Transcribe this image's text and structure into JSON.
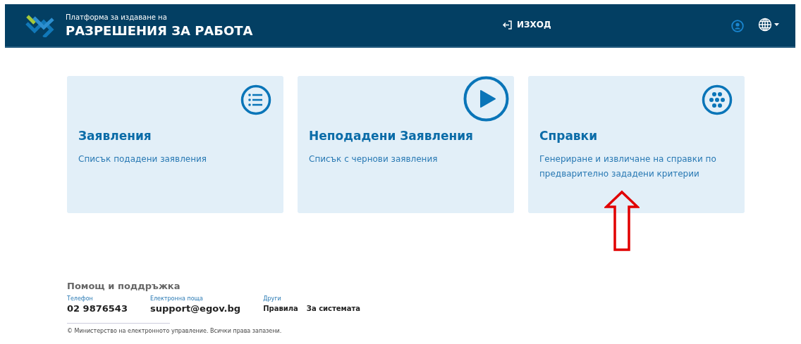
{
  "header": {
    "subtitle": "Платформа за издаване на",
    "title": "РАЗРЕШЕНИЯ ЗА РАБОТА",
    "logout": "ИЗХОД"
  },
  "cards": [
    {
      "kind": "list",
      "title": "Заявления",
      "description": "Списък подадени заявления"
    },
    {
      "kind": "play",
      "title": "Неподадени Заявления",
      "description": "Списък с чернови заявления"
    },
    {
      "kind": "dots",
      "title": "Справки",
      "description": "Генериране и извличане на справки по предварително зададени критерии"
    }
  ],
  "footer": {
    "heading": "Помощ и поддръжка",
    "columns": [
      {
        "label": "Телефон",
        "values": [
          "02 9876543"
        ],
        "kind": "contact"
      },
      {
        "label": "Електронна поща",
        "values": [
          "support@egov.bg"
        ],
        "kind": "contact"
      },
      {
        "label": "Други",
        "values": [
          "Правила",
          "За системата"
        ],
        "kind": "links"
      }
    ],
    "copyright": "© Министерство на електронното управление. Всички права запазени."
  }
}
